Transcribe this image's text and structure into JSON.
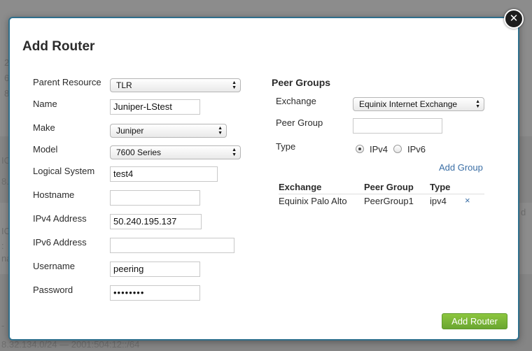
{
  "background": {
    "frag_top": [
      "2",
      "6",
      "8"
    ],
    "frag_mid": [
      "IO",
      "8."
    ],
    "frag_lower": [
      "IO",
      ":",
      "na"
    ],
    "frag_right": [
      "d"
    ],
    "frag_bottom_left": "-",
    "bottom_text": "8.32.134.0/24 — 2001:504:12::/64"
  },
  "modal": {
    "title": "Add Router",
    "close_label": "✕",
    "form": {
      "parent_resource": {
        "label": "Parent Resource",
        "value": "TLR"
      },
      "name": {
        "label": "Name",
        "value": "Juniper-LStest"
      },
      "make": {
        "label": "Make",
        "value": "Juniper"
      },
      "model": {
        "label": "Model",
        "value": "7600 Series"
      },
      "logical_system": {
        "label": "Logical System",
        "value": "test4"
      },
      "hostname": {
        "label": "Hostname",
        "value": ""
      },
      "ipv4": {
        "label": "IPv4 Address",
        "value": "50.240.195.137"
      },
      "ipv6": {
        "label": "IPv6 Address",
        "value": ""
      },
      "username": {
        "label": "Username",
        "value": "peering"
      },
      "password": {
        "label": "Password",
        "value": "••••••••"
      }
    },
    "peer_groups": {
      "title": "Peer Groups",
      "exchange": {
        "label": "Exchange",
        "value": "Equinix Internet Exchange"
      },
      "peer_group": {
        "label": "Peer Group",
        "value": ""
      },
      "type": {
        "label": "Type",
        "options": [
          "IPv4",
          "IPv6"
        ],
        "selected": "IPv4"
      },
      "add_group_label": "Add Group",
      "table": {
        "headers": [
          "Exchange",
          "Peer Group",
          "Type"
        ],
        "rows": [
          {
            "exchange": "Equinix Palo Alto",
            "peer_group": "PeerGroup1",
            "type": "ipv4",
            "remove": "×"
          }
        ]
      }
    },
    "submit_label": "Add Router"
  }
}
